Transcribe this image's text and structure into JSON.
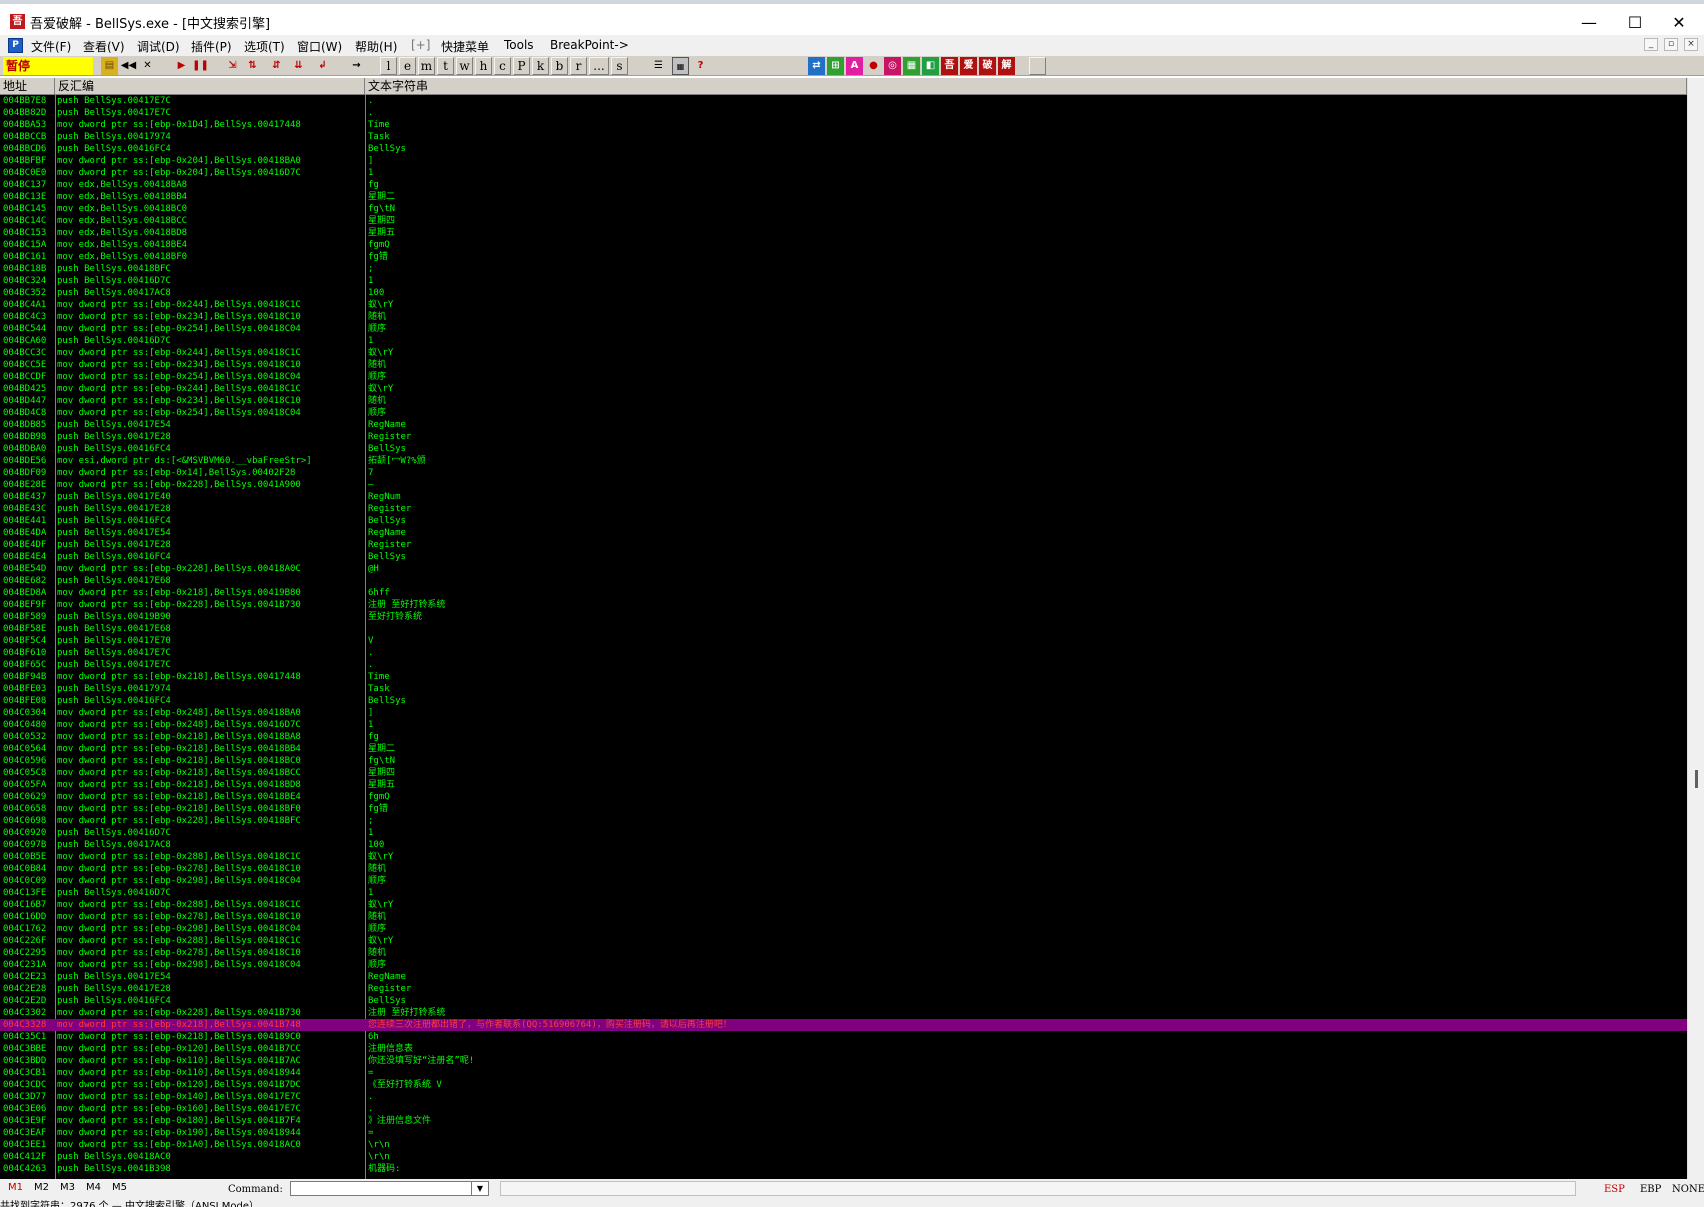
{
  "window": {
    "title": "吾爱破解 - BellSys.exe - [中文搜索引擎]",
    "app_icon_label": "吾爱",
    "controls": {
      "minimize": "—",
      "maximize": "☐",
      "close": "✕"
    }
  },
  "menu": {
    "items": [
      "文件(F)",
      "查看(V)",
      "调试(D)",
      "插件(P)",
      "选项(T)",
      "窗口(W)",
      "帮助(H)",
      "[+]",
      "快捷菜单",
      "Tools",
      "BreakPoint->"
    ],
    "mdi_controls": [
      "_",
      "▫",
      "×"
    ]
  },
  "toolbar": {
    "status": "暂停",
    "letter_buttons": [
      "l",
      "e",
      "m",
      "t",
      "w",
      "h",
      "c",
      "P",
      "k",
      "b",
      "r",
      "...",
      "s"
    ],
    "plugin_icons": [
      "吾",
      "爱",
      "破",
      "解"
    ]
  },
  "columns": {
    "address": "地址",
    "disassembly": "反汇编",
    "string": "文本字符串"
  },
  "rows": [
    {
      "addr": "004BB7E8",
      "dis": "push BellSys.00417E7C",
      "str": "."
    },
    {
      "addr": "004BB82D",
      "dis": "push BellSys.00417E7C",
      "str": "."
    },
    {
      "addr": "004BBA53",
      "dis": "mov dword ptr ss:[ebp-0x1D4],BellSys.00417448",
      "str": "Time"
    },
    {
      "addr": "004BBCCB",
      "dis": "push BellSys.00417974",
      "str": "Task"
    },
    {
      "addr": "004BBCD6",
      "dis": "push BellSys.00416FC4",
      "str": "BellSys"
    },
    {
      "addr": "004BBFBF",
      "dis": "mov dword ptr ss:[ebp-0x204],BellSys.00418BA0",
      "str": "]"
    },
    {
      "addr": "004BC0E0",
      "dis": "mov dword ptr ss:[ebp-0x204],BellSys.00416D7C",
      "str": "1"
    },
    {
      "addr": "004BC137",
      "dis": "mov edx,BellSys.00418BA8",
      "str": "fg"
    },
    {
      "addr": "004BC13E",
      "dis": "mov edx,BellSys.00418BB4",
      "str": "星期二"
    },
    {
      "addr": "004BC145",
      "dis": "mov edx,BellSys.00418BC0",
      "str": "fg\\tN"
    },
    {
      "addr": "004BC14C",
      "dis": "mov edx,BellSys.00418BCC",
      "str": "星期四"
    },
    {
      "addr": "004BC153",
      "dis": "mov edx,BellSys.00418BD8",
      "str": "星期五"
    },
    {
      "addr": "004BC15A",
      "dis": "mov edx,BellSys.00418BE4",
      "str": "fgmQ"
    },
    {
      "addr": "004BC161",
      "dis": "mov edx,BellSys.00418BF0",
      "str": "fg错"
    },
    {
      "addr": "004BC18B",
      "dis": "push BellSys.00418BFC",
      "str": ";"
    },
    {
      "addr": "004BC324",
      "dis": "push BellSys.00416D7C",
      "str": "1"
    },
    {
      "addr": "004BC352",
      "dis": "push BellSys.00417AC8",
      "str": "100"
    },
    {
      "addr": "004BC4A1",
      "dis": "mov dword ptr ss:[ebp-0x244],BellSys.00418C1C",
      "str": "蚁\\rY"
    },
    {
      "addr": "004BC4C3",
      "dis": "mov dword ptr ss:[ebp-0x234],BellSys.00418C10",
      "str": "随机"
    },
    {
      "addr": "004BC544",
      "dis": "mov dword ptr ss:[ebp-0x254],BellSys.00418C04",
      "str": "顺序"
    },
    {
      "addr": "004BCA60",
      "dis": "push BellSys.00416D7C",
      "str": "1"
    },
    {
      "addr": "004BCC3C",
      "dis": "mov dword ptr ss:[ebp-0x244],BellSys.00418C1C",
      "str": "蚁\\rY"
    },
    {
      "addr": "004BCC5E",
      "dis": "mov dword ptr ss:[ebp-0x234],BellSys.00418C10",
      "str": "随机"
    },
    {
      "addr": "004BCCDF",
      "dis": "mov dword ptr ss:[ebp-0x254],BellSys.00418C04",
      "str": "顺序"
    },
    {
      "addr": "004BD425",
      "dis": "mov dword ptr ss:[ebp-0x244],BellSys.00418C1C",
      "str": "蚁\\rY"
    },
    {
      "addr": "004BD447",
      "dis": "mov dword ptr ss:[ebp-0x234],BellSys.00418C10",
      "str": "随机"
    },
    {
      "addr": "004BD4C8",
      "dis": "mov dword ptr ss:[ebp-0x254],BellSys.00418C04",
      "str": "顺序"
    },
    {
      "addr": "004BDB85",
      "dis": "push BellSys.00417E54",
      "str": "RegName"
    },
    {
      "addr": "004BDB98",
      "dis": "push BellSys.00417E28",
      "str": "Register"
    },
    {
      "addr": "004BDBA0",
      "dis": "push BellSys.00416FC4",
      "str": "BellSys"
    },
    {
      "addr": "004BDE56",
      "dis": "mov esi,dword ptr ds:[<&MSVBVM60.__vbaFreeStr>]",
      "str": "拓颉[冖W?%颁"
    },
    {
      "addr": "004BDF09",
      "dis": "mov dword ptr ss:[ebp-0x14],BellSys.00402F28",
      "str": "7"
    },
    {
      "addr": "004BE28E",
      "dis": "mov dword ptr ss:[ebp-0x228],BellSys.0041A900",
      "str": "—"
    },
    {
      "addr": "004BE437",
      "dis": "push BellSys.00417E40",
      "str": "RegNum"
    },
    {
      "addr": "004BE43C",
      "dis": "push BellSys.00417E28",
      "str": "Register"
    },
    {
      "addr": "004BE441",
      "dis": "push BellSys.00416FC4",
      "str": "BellSys"
    },
    {
      "addr": "004BE4DA",
      "dis": "push BellSys.00417E54",
      "str": "RegName"
    },
    {
      "addr": "004BE4DF",
      "dis": "push BellSys.00417E28",
      "str": "Register"
    },
    {
      "addr": "004BE4E4",
      "dis": "push BellSys.00416FC4",
      "str": "BellSys"
    },
    {
      "addr": "004BE54D",
      "dis": "mov dword ptr ss:[ebp-0x228],BellSys.00418A0C",
      "str": "@H"
    },
    {
      "addr": "004BE682",
      "dis": "push BellSys.00417E68",
      "str": ""
    },
    {
      "addr": "004BED8A",
      "dis": "mov dword ptr ss:[ebp-0x218],BellSys.00419B80",
      "str": "6hff"
    },
    {
      "addr": "004BEF9F",
      "dis": "mov dword ptr ss:[ebp-0x228],BellSys.0041B730",
      "str": "注册 至好打铃系统"
    },
    {
      "addr": "004BF589",
      "dis": "push BellSys.00419B90",
      "str": "至好打铃系统"
    },
    {
      "addr": "004BF58E",
      "dis": "push BellSys.00417E68",
      "str": ""
    },
    {
      "addr": "004BF5C4",
      "dis": "push BellSys.00417E70",
      "str": " V"
    },
    {
      "addr": "004BF610",
      "dis": "push BellSys.00417E7C",
      "str": "."
    },
    {
      "addr": "004BF65C",
      "dis": "push BellSys.00417E7C",
      "str": "."
    },
    {
      "addr": "004BF94B",
      "dis": "mov dword ptr ss:[ebp-0x218],BellSys.00417448",
      "str": "Time"
    },
    {
      "addr": "004BFE03",
      "dis": "push BellSys.00417974",
      "str": "Task"
    },
    {
      "addr": "004BFE08",
      "dis": "push BellSys.00416FC4",
      "str": "BellSys"
    },
    {
      "addr": "004C0304",
      "dis": "mov dword ptr ss:[ebp-0x248],BellSys.00418BA0",
      "str": "]"
    },
    {
      "addr": "004C0480",
      "dis": "mov dword ptr ss:[ebp-0x248],BellSys.00416D7C",
      "str": "1"
    },
    {
      "addr": "004C0532",
      "dis": "mov dword ptr ss:[ebp-0x218],BellSys.00418BA8",
      "str": "fg"
    },
    {
      "addr": "004C0564",
      "dis": "mov dword ptr ss:[ebp-0x218],BellSys.00418BB4",
      "str": "星期二"
    },
    {
      "addr": "004C0596",
      "dis": "mov dword ptr ss:[ebp-0x218],BellSys.00418BC0",
      "str": "fg\\tN"
    },
    {
      "addr": "004C05C8",
      "dis": "mov dword ptr ss:[ebp-0x218],BellSys.00418BCC",
      "str": "星期四"
    },
    {
      "addr": "004C05FA",
      "dis": "mov dword ptr ss:[ebp-0x218],BellSys.00418BD8",
      "str": "星期五"
    },
    {
      "addr": "004C0629",
      "dis": "mov dword ptr ss:[ebp-0x218],BellSys.00418BE4",
      "str": "fgmQ"
    },
    {
      "addr": "004C0658",
      "dis": "mov dword ptr ss:[ebp-0x218],BellSys.00418BF0",
      "str": "fg错"
    },
    {
      "addr": "004C0698",
      "dis": "mov dword ptr ss:[ebp-0x228],BellSys.00418BFC",
      "str": ";"
    },
    {
      "addr": "004C0920",
      "dis": "push BellSys.00416D7C",
      "str": "1"
    },
    {
      "addr": "004C097B",
      "dis": "push BellSys.00417AC8",
      "str": "100"
    },
    {
      "addr": "004C0B5E",
      "dis": "mov dword ptr ss:[ebp-0x288],BellSys.00418C1C",
      "str": "蚁\\rY"
    },
    {
      "addr": "004C0B84",
      "dis": "mov dword ptr ss:[ebp-0x278],BellSys.00418C10",
      "str": "随机"
    },
    {
      "addr": "004C0C09",
      "dis": "mov dword ptr ss:[ebp-0x298],BellSys.00418C04",
      "str": "顺序"
    },
    {
      "addr": "004C13FE",
      "dis": "push BellSys.00416D7C",
      "str": "1"
    },
    {
      "addr": "004C16B7",
      "dis": "mov dword ptr ss:[ebp-0x288],BellSys.00418C1C",
      "str": "蚁\\rY"
    },
    {
      "addr": "004C16DD",
      "dis": "mov dword ptr ss:[ebp-0x278],BellSys.00418C10",
      "str": "随机"
    },
    {
      "addr": "004C1762",
      "dis": "mov dword ptr ss:[ebp-0x298],BellSys.00418C04",
      "str": "顺序"
    },
    {
      "addr": "004C226F",
      "dis": "mov dword ptr ss:[ebp-0x288],BellSys.00418C1C",
      "str": "蚁\\rY"
    },
    {
      "addr": "004C2295",
      "dis": "mov dword ptr ss:[ebp-0x278],BellSys.00418C10",
      "str": "随机"
    },
    {
      "addr": "004C231A",
      "dis": "mov dword ptr ss:[ebp-0x298],BellSys.00418C04",
      "str": "顺序"
    },
    {
      "addr": "004C2E23",
      "dis": "push BellSys.00417E54",
      "str": "RegName"
    },
    {
      "addr": "004C2E28",
      "dis": "push BellSys.00417E28",
      "str": "Register"
    },
    {
      "addr": "004C2E2D",
      "dis": "push BellSys.00416FC4",
      "str": "BellSys"
    },
    {
      "addr": "004C3302",
      "dis": "mov dword ptr ss:[ebp-0x228],BellSys.0041B730",
      "str": "注册 至好打铃系统"
    },
    {
      "addr": "004C3328",
      "dis": "mov dword ptr ss:[ebp-0x218],BellSys.0041B748",
      "str": "您连续三次注册都出错了，与作者联系(QQ:516906764)，购买注册码，请以后再注册吧！",
      "selected": true
    },
    {
      "addr": "004C35C1",
      "dis": "mov dword ptr ss:[ebp-0x218],BellSys.004189C0",
      "str": "6h"
    },
    {
      "addr": "004C3BBE",
      "dis": "mov dword ptr ss:[ebp-0x120],BellSys.0041B7CC",
      "str": "注册信息表"
    },
    {
      "addr": "004C3BDD",
      "dis": "mov dword ptr ss:[ebp-0x110],BellSys.0041B7AC",
      "str": "你还没填写好“注册名”呢!"
    },
    {
      "addr": "004C3CB1",
      "dis": "mov dword ptr ss:[ebp-0x110],BellSys.00418944",
      "str": "="
    },
    {
      "addr": "004C3CDC",
      "dis": "mov dword ptr ss:[ebp-0x120],BellSys.0041B7DC",
      "str": "《至好打铃系统 V"
    },
    {
      "addr": "004C3D77",
      "dis": "mov dword ptr ss:[ebp-0x140],BellSys.00417E7C",
      "str": "."
    },
    {
      "addr": "004C3E06",
      "dis": "mov dword ptr ss:[ebp-0x160],BellSys.00417E7C",
      "str": "."
    },
    {
      "addr": "004C3E9F",
      "dis": "mov dword ptr ss:[ebp-0x180],BellSys.0041B7F4",
      "str": "》注册信息文件"
    },
    {
      "addr": "004C3EAF",
      "dis": "mov dword ptr ss:[ebp-0x190],BellSys.00418944",
      "str": "="
    },
    {
      "addr": "004C3EE1",
      "dis": "mov dword ptr ss:[ebp-0x1A0],BellSys.00418AC0",
      "str": "\\r\\n"
    },
    {
      "addr": "004C412F",
      "dis": "push BellSys.00418AC0",
      "str": "\\r\\n"
    },
    {
      "addr": "004C4263",
      "dis": "push BellSys.0041B398",
      "str": "机器码:"
    }
  ],
  "command_bar": {
    "tabs": [
      "M1",
      "M2",
      "M3",
      "M4",
      "M5"
    ],
    "command_label": "Command:",
    "command_value": "",
    "registers": [
      "ESP",
      "EBP",
      "NONE"
    ]
  },
  "status_bar": {
    "text": "共找到字符串：2976 个 — 中文搜索引擎（ANSI Mode）"
  },
  "colors": {
    "listing_bg": "#000000",
    "listing_fg": "#00ff00",
    "selected_bg": "#800080",
    "selected_fg": "#ff3c3c",
    "status_bg": "#ffff00",
    "status_fg": "#c00000"
  }
}
